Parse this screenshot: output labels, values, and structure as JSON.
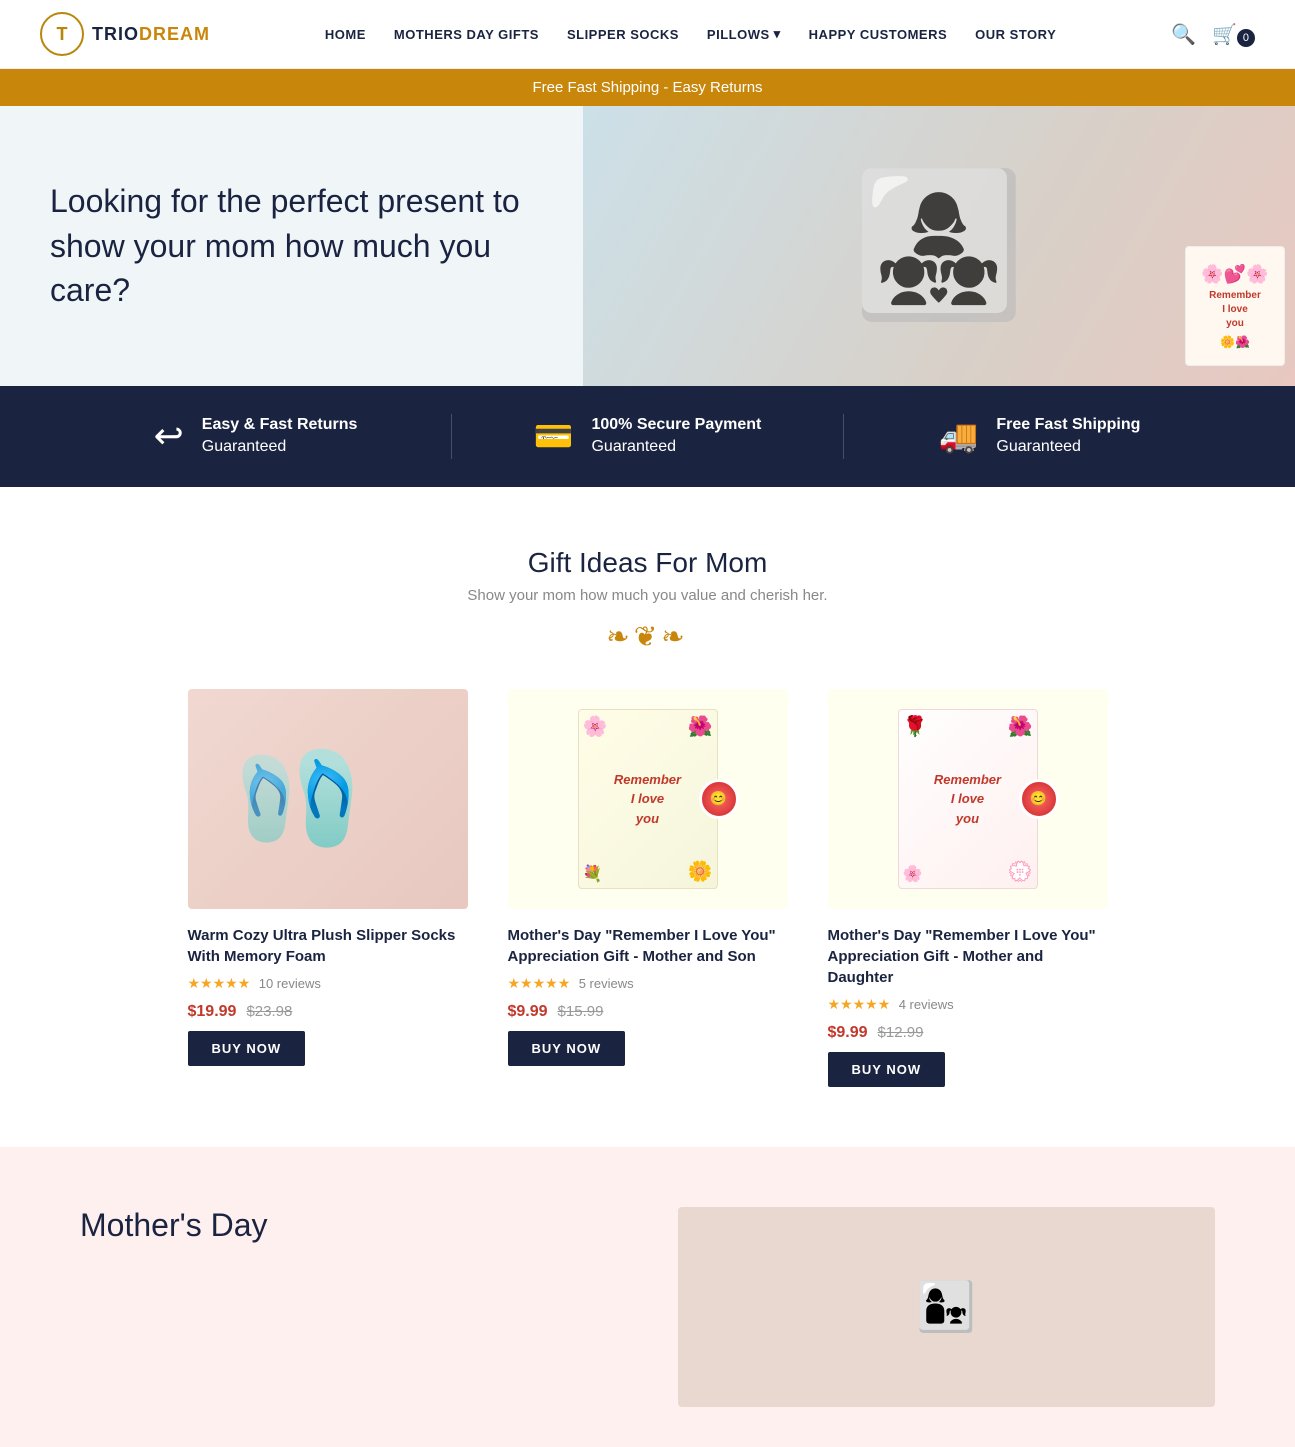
{
  "brand": {
    "name_part1": "TRIO",
    "name_part2": "DREAM",
    "logo_letter": "T"
  },
  "nav": {
    "links": [
      {
        "label": "HOME",
        "href": "#"
      },
      {
        "label": "MOTHERS DAY GIFTS",
        "href": "#"
      },
      {
        "label": "SLIPPER SOCKS",
        "href": "#"
      },
      {
        "label": "PILLOWS",
        "href": "#"
      },
      {
        "label": "HAPPY CUSTOMERS",
        "href": "#"
      },
      {
        "label": "OUR STORY",
        "href": "#"
      }
    ],
    "cart_count": "0"
  },
  "announcement": {
    "text": "Free Fast Shipping - Easy Returns"
  },
  "hero": {
    "heading": "Looking for the perfect present to show your mom how much you care?",
    "gift_card_text": "Remember\nI love\nyou"
  },
  "features": [
    {
      "icon": "↩",
      "title": "Easy & Fast Returns",
      "subtitle": "Guaranteed"
    },
    {
      "icon": "▤",
      "title": "100% Secure Payment",
      "subtitle": "Guaranteed"
    },
    {
      "icon": "🚚",
      "title": "Free Fast Shipping",
      "subtitle": "Guaranteed"
    }
  ],
  "gift_section": {
    "heading": "Gift Ideas For Mom",
    "subtext": "Show your mom how much you value and cherish her.",
    "ornament": "ʕ·͡ᴥ·ʔ"
  },
  "products": [
    {
      "id": "slipper-socks",
      "title": "Warm Cozy Ultra Plush Slipper Socks With Memory Foam",
      "stars": 5,
      "reviews": "10 reviews",
      "sale_price": "$19.99",
      "orig_price": "$23.98",
      "button": "BUY NOW",
      "type": "slipper"
    },
    {
      "id": "remember-son",
      "title": "Mother's Day \"Remember I Love You\" Appreciation Gift - Mother and Son",
      "stars": 5,
      "reviews": "5 reviews",
      "sale_price": "$9.99",
      "orig_price": "$15.99",
      "button": "BUY NOW",
      "type": "card-green"
    },
    {
      "id": "remember-daughter",
      "title": "Mother's Day \"Remember I Love You\" Appreciation Gift - Mother and Daughter",
      "stars": 5,
      "reviews": "4 reviews",
      "sale_price": "$9.99",
      "orig_price": "$12.99",
      "button": "BUY NOW",
      "type": "card-white"
    }
  ],
  "bottom_section": {
    "heading": "Mother's Day"
  }
}
